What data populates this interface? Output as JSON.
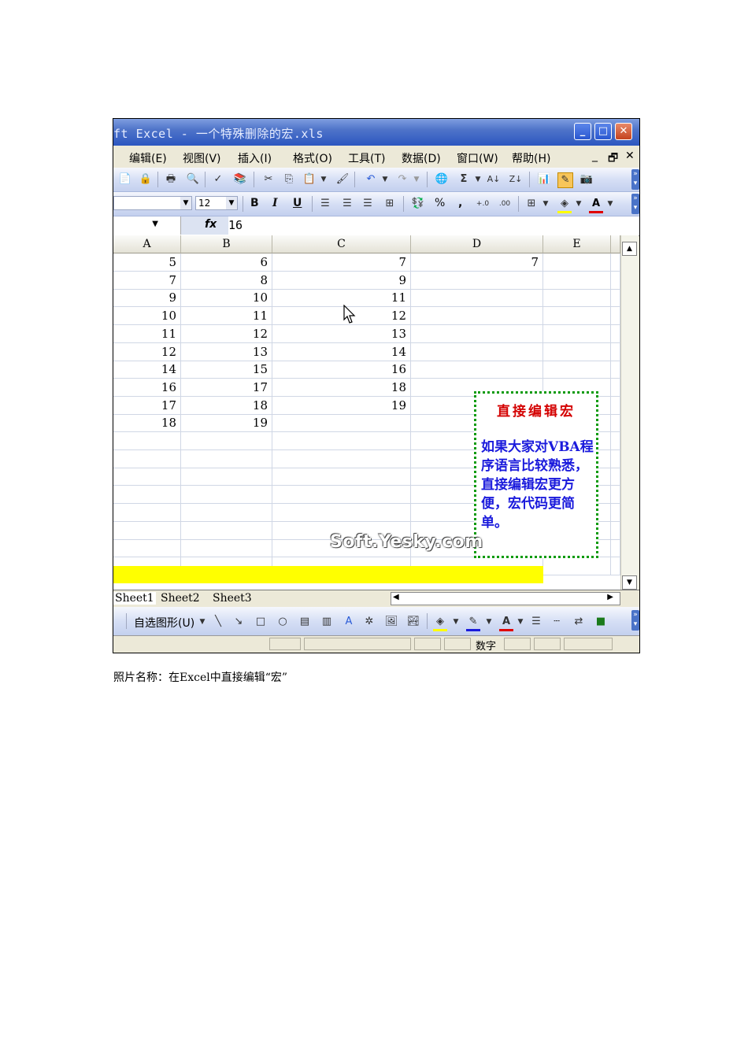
{
  "window": {
    "title": "ft Excel - 一个特殊删除的宏.xls",
    "buttons": {
      "minimize": "_",
      "maximize": "□",
      "close": "✕"
    }
  },
  "menubar": {
    "items": [
      "编辑(E)",
      "视图(V)",
      "插入(I)",
      "格式(O)",
      "工具(T)",
      "数据(D)",
      "窗口(W)",
      "帮助(H)"
    ],
    "controls": {
      "minimize": "_",
      "restore": "🗗",
      "close": "✕"
    }
  },
  "format_toolbar": {
    "font_size": "12",
    "bold": "B",
    "italic": "I",
    "underline": "U",
    "percent": "%",
    "comma": ","
  },
  "formula_bar": {
    "fx_label": "fx",
    "value": "16"
  },
  "columns": [
    "A",
    "B",
    "C",
    "D",
    "E"
  ],
  "rows": [
    [
      "5",
      "6",
      "7",
      "7",
      ""
    ],
    [
      "7",
      "8",
      "9",
      "",
      ""
    ],
    [
      "9",
      "10",
      "11",
      "",
      ""
    ],
    [
      "10",
      "11",
      "12",
      "",
      ""
    ],
    [
      "11",
      "12",
      "13",
      "",
      ""
    ],
    [
      "12",
      "13",
      "14",
      "",
      ""
    ],
    [
      "14",
      "15",
      "16",
      "",
      ""
    ],
    [
      "16",
      "17",
      "18",
      "",
      ""
    ],
    [
      "17",
      "18",
      "19",
      "",
      ""
    ],
    [
      "18",
      "19",
      "",
      "",
      ""
    ]
  ],
  "note": {
    "heading": "直接编辑宏",
    "body": "如果大家对VBA程序语言比较熟悉，直接编辑宏更方便，宏代码更简单。"
  },
  "watermark": "Soft.Yesky.com",
  "sheet_tabs": [
    "Sheet1",
    "Sheet2",
    "Sheet3"
  ],
  "drawing_toolbar": {
    "autoshapes_label": "自选图形(U)"
  },
  "statusbar": {
    "mode": "数字"
  },
  "caption": "照片名称：在Excel中直接编辑“宏”",
  "colors": {
    "highlight_row": "#ffff00",
    "note_border": "#0a9a0a",
    "note_heading": "#d40000",
    "note_body": "#1a1adc"
  }
}
